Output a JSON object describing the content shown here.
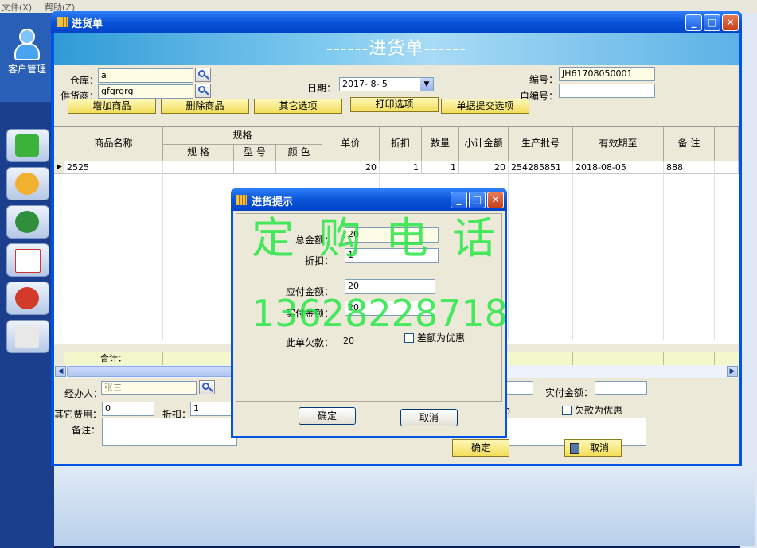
{
  "background_app": {
    "menu_file": "文件(X)",
    "menu_help": "帮助(Z)",
    "sidebar_title": "客户管理"
  },
  "window": {
    "title": "进货单",
    "header": "------进货单------",
    "warehouse_label": "仓库：",
    "warehouse_value": "a",
    "supplier_label": "供货商：",
    "supplier_value": "gfgrgrg",
    "date_label": "日期：",
    "date_value": "2017- 8- 5",
    "number_label": "编号：",
    "number_value": "JH61708050001",
    "self_number_label": "自编号：",
    "self_number_value": "",
    "buttons": {
      "add_product": "增加商品",
      "delete_product": "删除商品",
      "other_options": "其它选项",
      "print_options": "打印选项",
      "submit_options": "单据提交选项"
    }
  },
  "grid": {
    "headers": {
      "product_name": "商品名称",
      "spec": "规格",
      "spec_size": "规    格",
      "model": "型    号",
      "color": "颜    色",
      "unit_price": "单价",
      "discount": "折扣",
      "quantity": "数量",
      "subtotal": "小计金额",
      "batch": "生产批号",
      "expiry": "有效期至",
      "remark": "备  注"
    },
    "rows": [
      {
        "product_name": "2525",
        "spec_size": "",
        "model": "",
        "color": "",
        "unit_price": "20",
        "discount": "1",
        "quantity": "1",
        "subtotal": "20",
        "batch": "254285851",
        "expiry": "2018-08-05",
        "remark": "888"
      }
    ],
    "total_label": "合计："
  },
  "footer": {
    "handler_label": "经办人：",
    "handler_value": "张三",
    "other_fee_label": "其它费用：",
    "other_fee_value": "0",
    "discount_label": "折扣：",
    "discount_value": "1",
    "paid_label": "实付金额：",
    "paid_value": "",
    "remark_label": "备注：",
    "partial_value": "0",
    "debt_as_discount": "欠款为优惠",
    "ok_button": "确定",
    "cancel_button": "取消"
  },
  "dialog": {
    "title": "进货提示",
    "total_label": "总金额：",
    "total_value": "20",
    "discount_label": "折扣：",
    "discount_value": "1",
    "payable_label": "应付金额：",
    "payable_value": "20",
    "paid_label": "实付金额：",
    "paid_value": "20",
    "debt_label": "此单欠款：",
    "debt_value": "20",
    "diff_discount_label": "差额为优惠",
    "ok": "确定",
    "cancel": "取消"
  },
  "watermark": {
    "line1": "定购电话",
    "line2": "13628228718"
  }
}
